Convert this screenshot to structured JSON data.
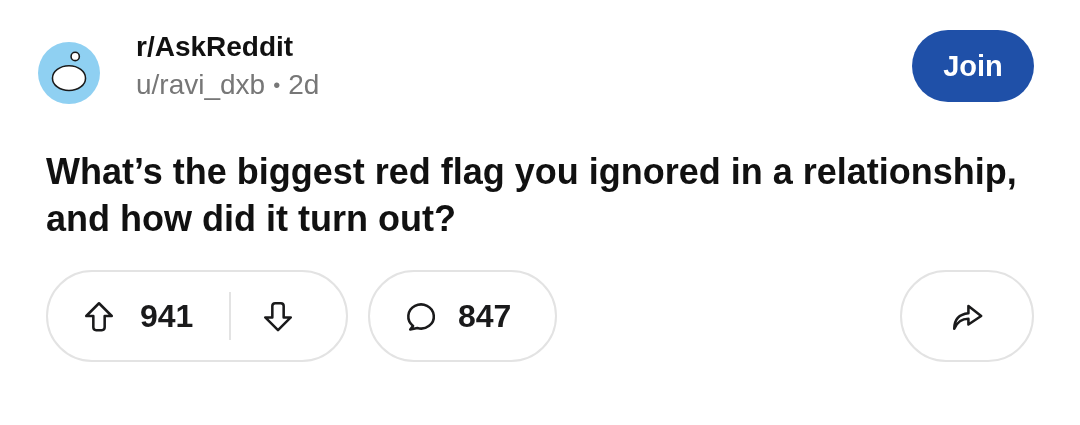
{
  "community": {
    "name": "r/AskReddit",
    "author": "u/ravi_dxb",
    "separator": "•",
    "age": "2d"
  },
  "join_button": {
    "label": "Join"
  },
  "post": {
    "title": "What’s the biggest red flag you ignored in a relationship, and how did it turn out?"
  },
  "actions": {
    "upvotes": "941",
    "comments": "847"
  }
}
